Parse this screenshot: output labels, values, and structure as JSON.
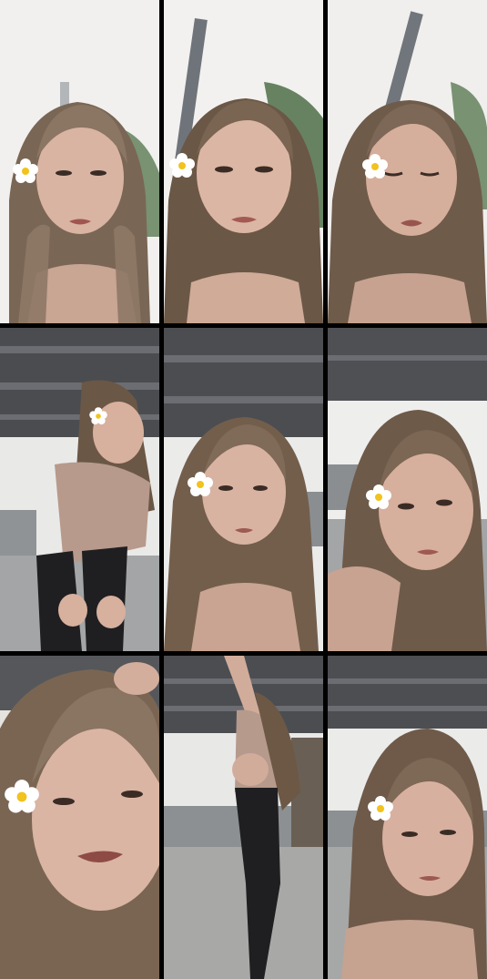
{
  "layout": {
    "columns": 3,
    "rows": 3,
    "gap_color": "#000000"
  },
  "palette": {
    "sky": "#eeeeec",
    "sky_warm": "#f4f1ee",
    "hair": "#6e5a4b",
    "hair_light": "#a08b78",
    "skin": "#d8b3a2",
    "skin_shadow": "#b9907e",
    "top": "#a98f82",
    "leggings": "#1f1f22",
    "canopy": "#4a4c50",
    "canopy_light": "#6b6d72",
    "pavement": "#a3a5a6",
    "tree": "#4f6e48",
    "flower_petal": "#ffffff",
    "flower_center": "#f2c21d"
  },
  "tiles": [
    {
      "id": "r1c1",
      "scene": "sky-tree",
      "pose": "face-close",
      "flower": "left"
    },
    {
      "id": "r1c2",
      "scene": "sky-tree",
      "pose": "face-close",
      "flower": "left"
    },
    {
      "id": "r1c3",
      "scene": "sky-tree",
      "pose": "face-close-eyes-closed",
      "flower": "left"
    },
    {
      "id": "r2c1",
      "scene": "canopy",
      "pose": "bending-forward",
      "flower": "left"
    },
    {
      "id": "r2c2",
      "scene": "canopy",
      "pose": "face-mid",
      "flower": "left"
    },
    {
      "id": "r2c3",
      "scene": "canopy",
      "pose": "face-tilted",
      "flower": "left"
    },
    {
      "id": "r3c1",
      "scene": "close",
      "pose": "face-very-close-hand",
      "flower": "left"
    },
    {
      "id": "r3c2",
      "scene": "canopy-plaza",
      "pose": "standing-arm-up",
      "flower": "none"
    },
    {
      "id": "r3c3",
      "scene": "canopy",
      "pose": "face-mid-down",
      "flower": "left"
    }
  ]
}
